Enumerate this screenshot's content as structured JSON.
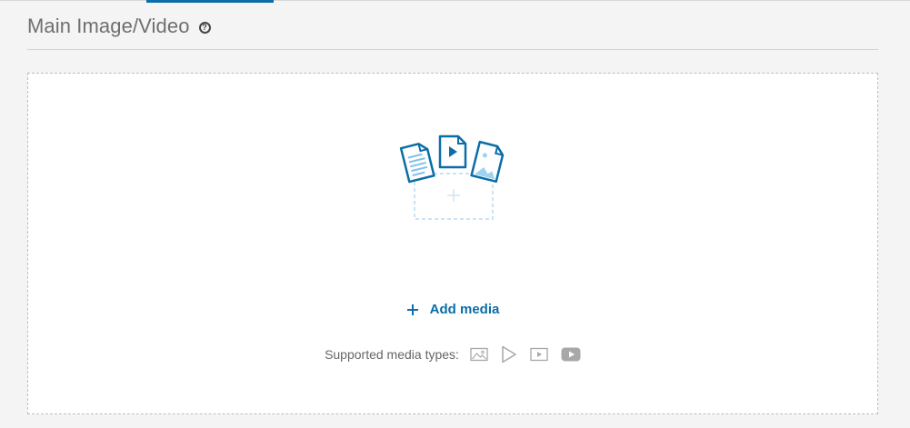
{
  "section": {
    "title": "Main Image/Video",
    "help_icon": "question-circle-icon"
  },
  "dropzone": {
    "illustration": "media-files-upload-icon",
    "add_label": "Add media",
    "add_icon": "plus-icon",
    "supported_label": "Supported media types:",
    "supported_types": [
      {
        "name": "image",
        "icon": "image-icon"
      },
      {
        "name": "video",
        "icon": "play-icon"
      },
      {
        "name": "video-file",
        "icon": "video-player-icon"
      },
      {
        "name": "youtube",
        "icon": "youtube-icon"
      }
    ]
  },
  "colors": {
    "accent": "#0b6ea8",
    "illustration_light": "#cfe6f5",
    "muted_icon": "#a8a8a8",
    "background": "#f4f4f4"
  }
}
